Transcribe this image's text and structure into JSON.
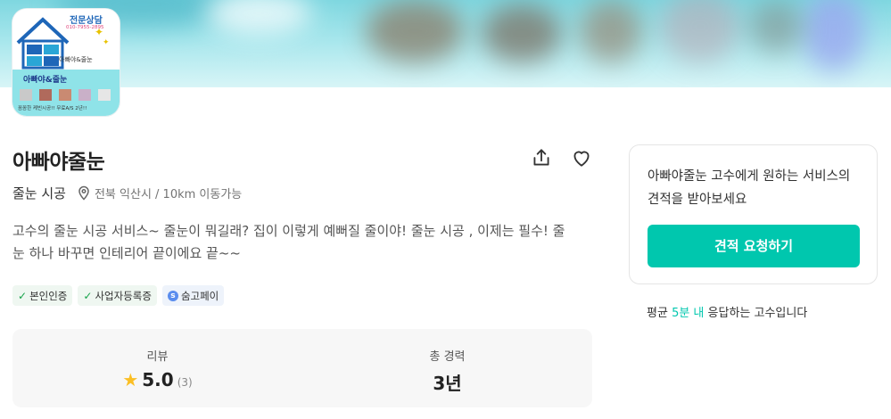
{
  "logo": {
    "top_text": "전문상담",
    "phone": "010-7955-2895",
    "brand_small": "아빠야&줄눈",
    "brand": "아빠야&줄눈",
    "tagline": "꼼꼼한 케빈시공!! 무료A/S 2년!!"
  },
  "profile": {
    "name": "아빠야줄눈",
    "category": "줄눈 시공",
    "location": "전북 익산시 / 10km 이동가능",
    "description": "고수의 줄눈 시공 서비스~ 줄눈이 뭐길래? 집이 이렇게 예뻐질 줄이야! 줄눈 시공 , 이제는 필수! 줄눈 하나 바꾸면 인테리어 끝이에요 끝~~",
    "badges": [
      {
        "label": "본인인증",
        "icon": "check-icon"
      },
      {
        "label": "사업자등록증",
        "icon": "check-icon"
      },
      {
        "label": "숨고페이",
        "icon": "soomgo-pay-icon"
      }
    ]
  },
  "stats": {
    "review_label": "리뷰",
    "rating": "5.0",
    "review_count": "(3)",
    "career_label": "총 경력",
    "career_value": "3년"
  },
  "card": {
    "prompt": "아빠야줄눈 고수에게 원하는 서비스의 견적을 받아보세요",
    "button": "견적 요청하기"
  },
  "response": {
    "prefix": "평균 ",
    "highlight": "5분 내",
    "suffix": " 응답하는 고수입니다"
  },
  "colors": {
    "accent": "#00c7ae",
    "star": "#fbbf24",
    "verified": "#16a34a"
  }
}
